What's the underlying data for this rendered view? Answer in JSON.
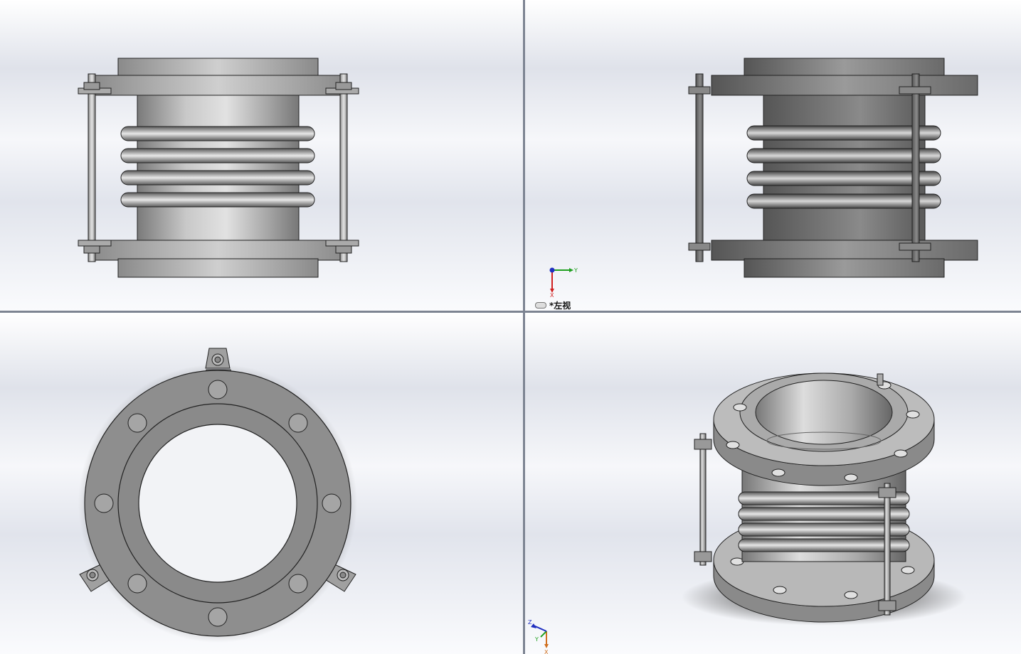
{
  "viewports": {
    "front": {
      "name": "front-view"
    },
    "left": {
      "name": "left-view",
      "label": "*左视",
      "triad": {
        "x": "X",
        "y": "Y"
      }
    },
    "top": {
      "name": "top-view"
    },
    "iso": {
      "name": "isometric-view",
      "triad": {
        "x": "X",
        "y": "Y",
        "z": "Z"
      }
    }
  },
  "colors": {
    "metal_light": "#c9c9c9",
    "metal_mid": "#a9a9a9",
    "metal_dark": "#6a6a6a",
    "outline": "#1a1a1a",
    "axis_x": "#d02020",
    "axis_y": "#20a020",
    "axis_z": "#2030c0",
    "divider": "#7d8492"
  }
}
